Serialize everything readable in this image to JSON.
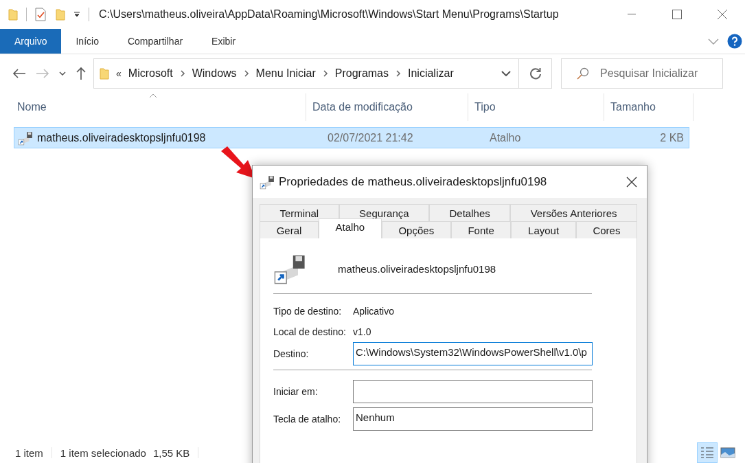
{
  "window": {
    "path": "C:\\Users\\matheus.oliveira\\AppData\\Roaming\\Microsoft\\Windows\\Start Menu\\Programs\\Startup"
  },
  "ribbon_tabs": [
    {
      "label": "Arquivo",
      "selected": true
    },
    {
      "label": "Início",
      "selected": false
    },
    {
      "label": "Compartilhar",
      "selected": false
    },
    {
      "label": "Exibir",
      "selected": false
    }
  ],
  "address": {
    "overflow": "«",
    "breadcrumbs": [
      "Microsoft",
      "Windows",
      "Menu Iniciar",
      "Programas",
      "Inicializar"
    ]
  },
  "search": {
    "placeholder": "Pesquisar Inicializar"
  },
  "columns": [
    {
      "label": "Nome",
      "sorted": true
    },
    {
      "label": "Data de modificação",
      "sorted": false
    },
    {
      "label": "Tipo",
      "sorted": false
    },
    {
      "label": "Tamanho",
      "sorted": false
    }
  ],
  "rows": [
    {
      "name": "matheus.oliveiradesktopsljnfu0198",
      "date": "02/07/2021 21:42",
      "type": "Atalho",
      "size": "2 KB",
      "selected": true
    }
  ],
  "status_bar": {
    "count": "1 item",
    "selection": "1 item selecionado",
    "size": "1,55 KB"
  },
  "view_buttons": [
    {
      "kind": "details",
      "selected": true
    },
    {
      "kind": "tiles",
      "selected": false
    }
  ],
  "dialog": {
    "title": "Propriedades de matheus.oliveiradesktopsljnfu0198",
    "tabs_back": [
      {
        "label": "Terminal",
        "selected": false
      },
      {
        "label": "Segurança",
        "selected": false
      },
      {
        "label": "Detalhes",
        "selected": false
      },
      {
        "label": "Versões Anteriores",
        "selected": false
      }
    ],
    "tabs_front": [
      {
        "label": "Geral",
        "selected": false
      },
      {
        "label": "Atalho",
        "selected": true
      },
      {
        "label": "Opções",
        "selected": false
      },
      {
        "label": "Fonte",
        "selected": false
      },
      {
        "label": "Layout",
        "selected": false
      },
      {
        "label": "Cores",
        "selected": false
      }
    ],
    "shortcut_name": "matheus.oliveiradesktopsljnfu0198",
    "fields": [
      {
        "kind": "text",
        "label": "Tipo de destino:",
        "value": "Aplicativo"
      },
      {
        "kind": "text",
        "label": "Local de destino:",
        "value": "v1.0"
      },
      {
        "kind": "input",
        "label": "Destino:",
        "value": "C:\\Windows\\System32\\WindowsPowerShell\\v1.0\\p",
        "focused": true
      },
      {
        "kind": "divider"
      },
      {
        "kind": "input",
        "label": "Iniciar em:",
        "focused": false
      },
      {
        "kind": "input",
        "label": "Tecla de atalho:",
        "value": "Nenhum",
        "focused": false
      }
    ]
  }
}
